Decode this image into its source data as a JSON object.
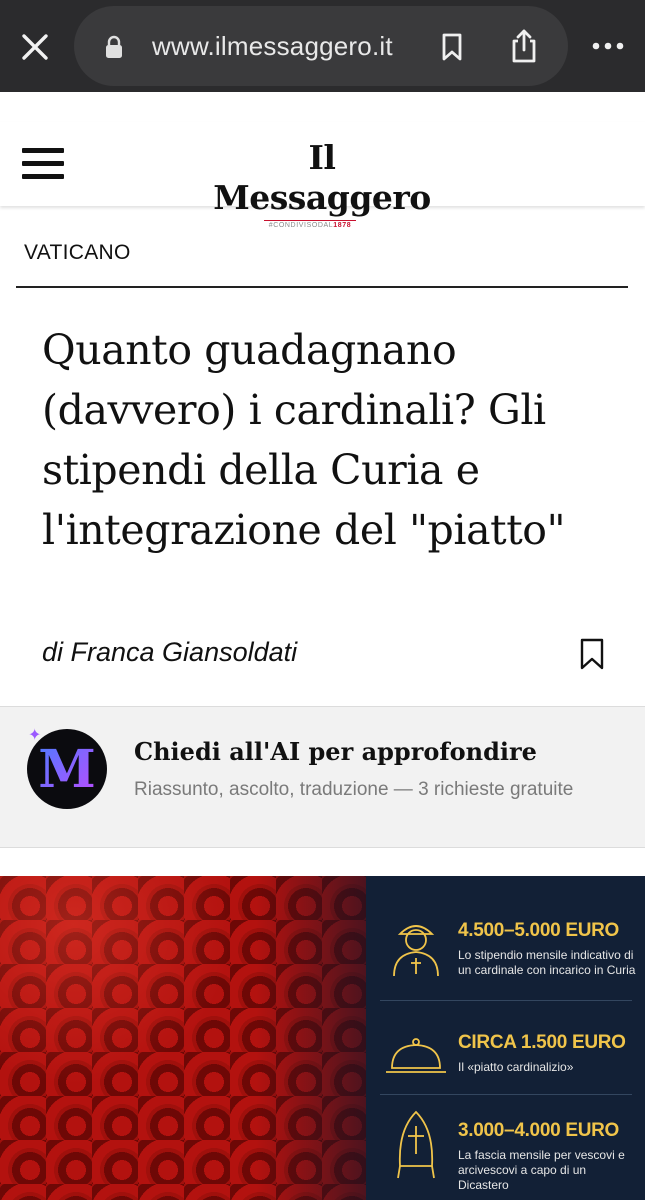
{
  "browser": {
    "url": "www.ilmessaggero.it"
  },
  "header": {
    "logo": "Il Messaggero",
    "logo_tagline_prefix": "#CONDIVISODAL",
    "logo_tagline_year": "1878"
  },
  "article": {
    "section": "VATICANO",
    "headline": "Quanto guadagnano (davvero) i cardinali? Gli stipendi della Curia e l'integrazione del \"piatto\"",
    "byline": "di Franca Giansoldati"
  },
  "ai_box": {
    "avatar_letter": "M",
    "title": "Chiedi all'AI per approfondire",
    "subtitle": "Riassunto, ascolto, traduzione — 3 richieste gratuite"
  },
  "infographic": {
    "items": [
      {
        "icon": "cardinal-icon",
        "amount": "4.500–5.000 EURO",
        "description": "Lo stipendio mensile indicativo di un cardinale con incarico in Curia"
      },
      {
        "icon": "cloche-icon",
        "amount": "CIRCA 1.500 EURO",
        "description": "Il «piatto cardinalizio»"
      },
      {
        "icon": "mitre-icon",
        "amount": "3.000–4.000 EURO",
        "description": "La fascia mensile per vescovi e arcivescovi a capo di un Dicastero"
      }
    ]
  },
  "colors": {
    "browser_bar": "#2b2b2d",
    "panel_navy": "#122036",
    "accent_gold": "#f0c44a",
    "cardinal_red": "#b3120f"
  }
}
